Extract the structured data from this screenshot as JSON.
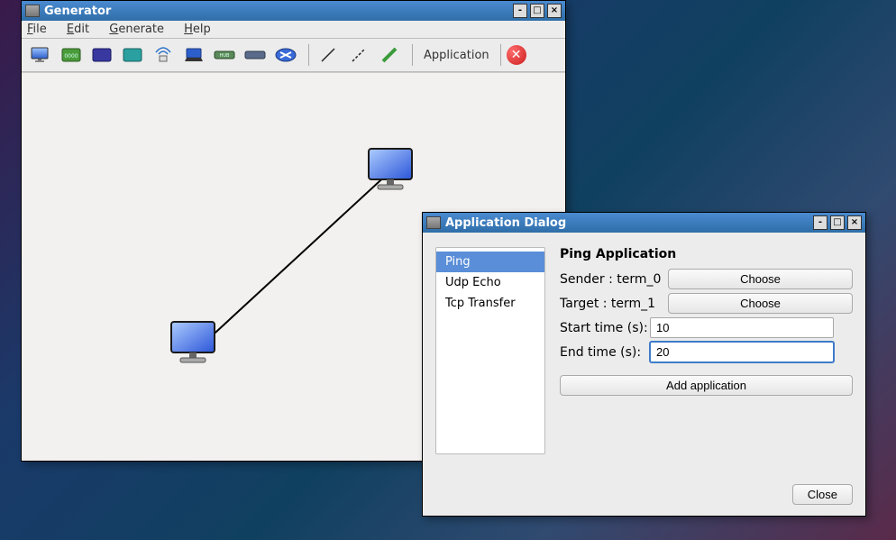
{
  "generator": {
    "title": "Generator",
    "menu": {
      "file": "File",
      "edit": "Edit",
      "generate": "Generate",
      "help": "Help"
    },
    "toolbar": {
      "application_label": "Application"
    }
  },
  "dialog": {
    "title": "Application Dialog",
    "list": {
      "items": [
        "Ping",
        "Udp Echo",
        "Tcp Transfer"
      ],
      "selected": 0
    },
    "form": {
      "heading": "Ping Application",
      "sender_label": "Sender : term_0",
      "target_label": "Target : term_1",
      "choose_btn": "Choose",
      "start_label": "Start time (s):",
      "start_value": "10",
      "end_label": "End time (s):",
      "end_value": "20",
      "add_btn": "Add application",
      "close_btn": "Close"
    }
  }
}
